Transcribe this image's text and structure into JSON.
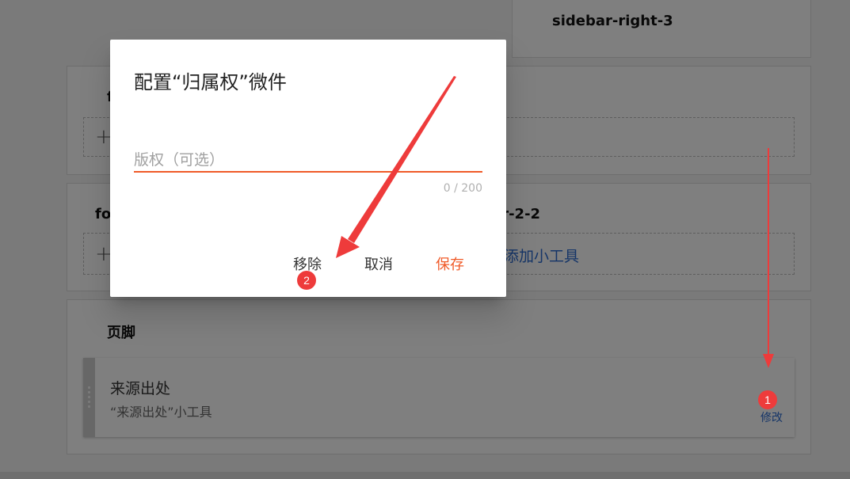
{
  "background": {
    "sidebar_right_3": "sidebar-right-3",
    "panel_2_title_fragment": "f",
    "panel_3_title_left": "fo",
    "panel_3_title_right": "er-2-2",
    "add_widget_label": "添加小工具",
    "footer": {
      "title": "页脚",
      "widget": {
        "title": "来源出处",
        "description": "“来源出处”小工具",
        "edit_label": "修改"
      }
    }
  },
  "dialog": {
    "title": "配置“归属权”微件",
    "field": {
      "placeholder": "版权（可选）",
      "value": "",
      "counter": "0 / 200"
    },
    "buttons": {
      "remove": "移除",
      "cancel": "取消",
      "save": "保存"
    }
  },
  "annotations": {
    "badge_1": "1",
    "badge_2": "2"
  },
  "colors": {
    "accent": "#f05a28",
    "link": "#2b6bd1",
    "annotation": "#ee3b3b"
  }
}
